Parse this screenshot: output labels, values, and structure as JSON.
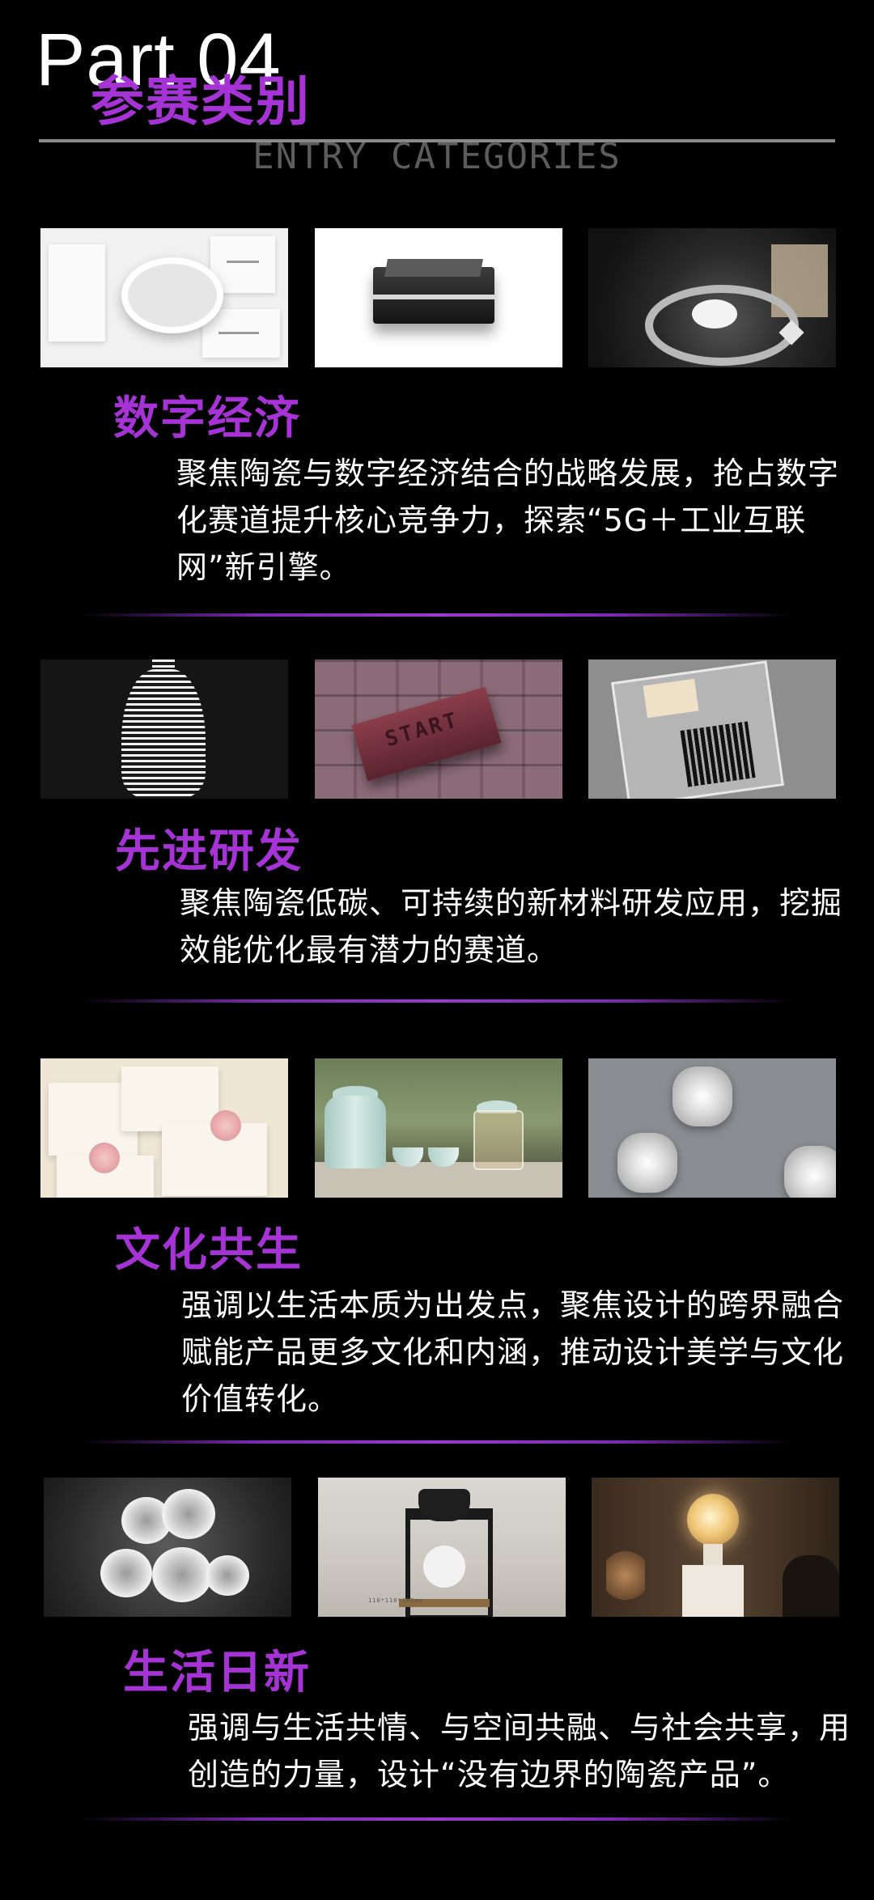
{
  "header": {
    "part": "Part 04",
    "title": "参赛类别",
    "subtitle": "ENTRY CATEGORIES"
  },
  "colors": {
    "background": "#000000",
    "accent_purple": "#a633d6",
    "divider_purple": "#8a30c0",
    "header_rule": "#8a8a8a",
    "subtitle_gray": "#5c5c5c",
    "body_text": "#ffffff"
  },
  "categories": [
    {
      "title": "数字经济",
      "desc": "聚焦陶瓷与数字经济结合的战略发展，抢占数字化赛道提升核心竞争力，探索“5G＋工业互联网”新引擎。"
    },
    {
      "title": "先进研发",
      "desc": "聚焦陶瓷低碳、可持续的新材料研发应用，挖掘效能优化最有潜力的赛道。"
    },
    {
      "title": "文化共生",
      "desc": "强调以生活本质为出发点，聚焦设计的跨界融合赋能产品更多文化和内涵，推动设计美学与文化价值转化。"
    },
    {
      "title": "生活日新",
      "desc": "强调与生活共情、与空间共融、与社会共享，用创造的力量，设计“没有边界的陶瓷产品”。"
    }
  ],
  "image_text": {
    "brick_label": "START",
    "dripper_caption": "110*110*186mm"
  }
}
